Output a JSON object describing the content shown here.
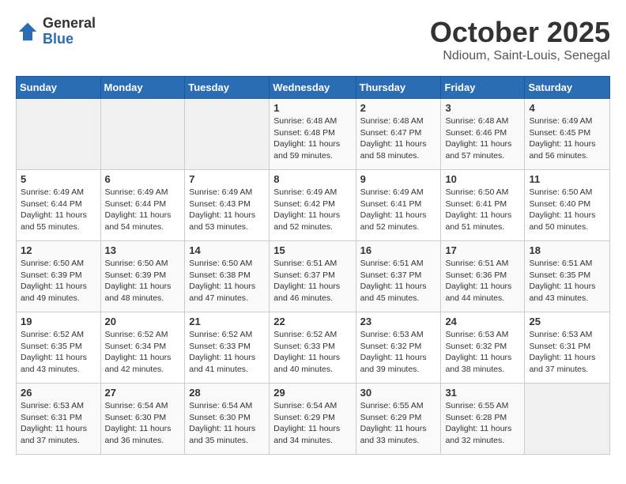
{
  "header": {
    "logo": {
      "general": "General",
      "blue": "Blue"
    },
    "month": "October 2025",
    "location": "Ndioum, Saint-Louis, Senegal"
  },
  "weekdays": [
    "Sunday",
    "Monday",
    "Tuesday",
    "Wednesday",
    "Thursday",
    "Friday",
    "Saturday"
  ],
  "weeks": [
    [
      {
        "day": "",
        "info": ""
      },
      {
        "day": "",
        "info": ""
      },
      {
        "day": "",
        "info": ""
      },
      {
        "day": "1",
        "info": "Sunrise: 6:48 AM\nSunset: 6:48 PM\nDaylight: 11 hours\nand 59 minutes."
      },
      {
        "day": "2",
        "info": "Sunrise: 6:48 AM\nSunset: 6:47 PM\nDaylight: 11 hours\nand 58 minutes."
      },
      {
        "day": "3",
        "info": "Sunrise: 6:48 AM\nSunset: 6:46 PM\nDaylight: 11 hours\nand 57 minutes."
      },
      {
        "day": "4",
        "info": "Sunrise: 6:49 AM\nSunset: 6:45 PM\nDaylight: 11 hours\nand 56 minutes."
      }
    ],
    [
      {
        "day": "5",
        "info": "Sunrise: 6:49 AM\nSunset: 6:44 PM\nDaylight: 11 hours\nand 55 minutes."
      },
      {
        "day": "6",
        "info": "Sunrise: 6:49 AM\nSunset: 6:44 PM\nDaylight: 11 hours\nand 54 minutes."
      },
      {
        "day": "7",
        "info": "Sunrise: 6:49 AM\nSunset: 6:43 PM\nDaylight: 11 hours\nand 53 minutes."
      },
      {
        "day": "8",
        "info": "Sunrise: 6:49 AM\nSunset: 6:42 PM\nDaylight: 11 hours\nand 52 minutes."
      },
      {
        "day": "9",
        "info": "Sunrise: 6:49 AM\nSunset: 6:41 PM\nDaylight: 11 hours\nand 52 minutes."
      },
      {
        "day": "10",
        "info": "Sunrise: 6:50 AM\nSunset: 6:41 PM\nDaylight: 11 hours\nand 51 minutes."
      },
      {
        "day": "11",
        "info": "Sunrise: 6:50 AM\nSunset: 6:40 PM\nDaylight: 11 hours\nand 50 minutes."
      }
    ],
    [
      {
        "day": "12",
        "info": "Sunrise: 6:50 AM\nSunset: 6:39 PM\nDaylight: 11 hours\nand 49 minutes."
      },
      {
        "day": "13",
        "info": "Sunrise: 6:50 AM\nSunset: 6:39 PM\nDaylight: 11 hours\nand 48 minutes."
      },
      {
        "day": "14",
        "info": "Sunrise: 6:50 AM\nSunset: 6:38 PM\nDaylight: 11 hours\nand 47 minutes."
      },
      {
        "day": "15",
        "info": "Sunrise: 6:51 AM\nSunset: 6:37 PM\nDaylight: 11 hours\nand 46 minutes."
      },
      {
        "day": "16",
        "info": "Sunrise: 6:51 AM\nSunset: 6:37 PM\nDaylight: 11 hours\nand 45 minutes."
      },
      {
        "day": "17",
        "info": "Sunrise: 6:51 AM\nSunset: 6:36 PM\nDaylight: 11 hours\nand 44 minutes."
      },
      {
        "day": "18",
        "info": "Sunrise: 6:51 AM\nSunset: 6:35 PM\nDaylight: 11 hours\nand 43 minutes."
      }
    ],
    [
      {
        "day": "19",
        "info": "Sunrise: 6:52 AM\nSunset: 6:35 PM\nDaylight: 11 hours\nand 43 minutes."
      },
      {
        "day": "20",
        "info": "Sunrise: 6:52 AM\nSunset: 6:34 PM\nDaylight: 11 hours\nand 42 minutes."
      },
      {
        "day": "21",
        "info": "Sunrise: 6:52 AM\nSunset: 6:33 PM\nDaylight: 11 hours\nand 41 minutes."
      },
      {
        "day": "22",
        "info": "Sunrise: 6:52 AM\nSunset: 6:33 PM\nDaylight: 11 hours\nand 40 minutes."
      },
      {
        "day": "23",
        "info": "Sunrise: 6:53 AM\nSunset: 6:32 PM\nDaylight: 11 hours\nand 39 minutes."
      },
      {
        "day": "24",
        "info": "Sunrise: 6:53 AM\nSunset: 6:32 PM\nDaylight: 11 hours\nand 38 minutes."
      },
      {
        "day": "25",
        "info": "Sunrise: 6:53 AM\nSunset: 6:31 PM\nDaylight: 11 hours\nand 37 minutes."
      }
    ],
    [
      {
        "day": "26",
        "info": "Sunrise: 6:53 AM\nSunset: 6:31 PM\nDaylight: 11 hours\nand 37 minutes."
      },
      {
        "day": "27",
        "info": "Sunrise: 6:54 AM\nSunset: 6:30 PM\nDaylight: 11 hours\nand 36 minutes."
      },
      {
        "day": "28",
        "info": "Sunrise: 6:54 AM\nSunset: 6:30 PM\nDaylight: 11 hours\nand 35 minutes."
      },
      {
        "day": "29",
        "info": "Sunrise: 6:54 AM\nSunset: 6:29 PM\nDaylight: 11 hours\nand 34 minutes."
      },
      {
        "day": "30",
        "info": "Sunrise: 6:55 AM\nSunset: 6:29 PM\nDaylight: 11 hours\nand 33 minutes."
      },
      {
        "day": "31",
        "info": "Sunrise: 6:55 AM\nSunset: 6:28 PM\nDaylight: 11 hours\nand 32 minutes."
      },
      {
        "day": "",
        "info": ""
      }
    ]
  ]
}
